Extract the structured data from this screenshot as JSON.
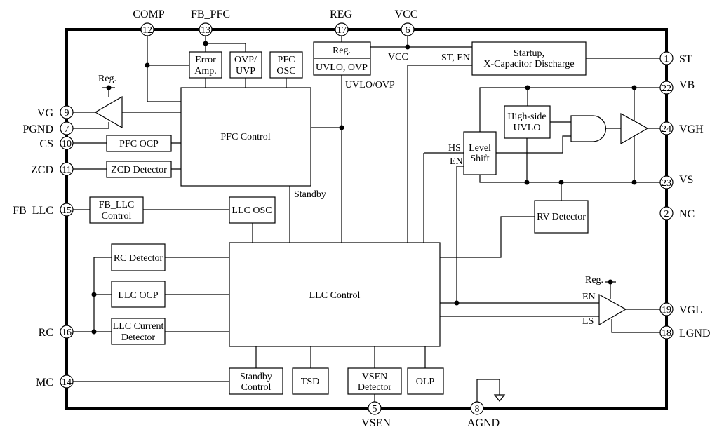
{
  "pins": {
    "comp": {
      "num": "12",
      "label": "COMP"
    },
    "fb_pfc": {
      "num": "13",
      "label": "FB_PFC"
    },
    "reg": {
      "num": "17",
      "label": "REG"
    },
    "vcc": {
      "num": "6",
      "label": "VCC"
    },
    "vg": {
      "num": "9",
      "label": "VG"
    },
    "pgnd": {
      "num": "7",
      "label": "PGND"
    },
    "cs": {
      "num": "10",
      "label": "CS"
    },
    "zcd": {
      "num": "11",
      "label": "ZCD"
    },
    "fb_llc": {
      "num": "15",
      "label": "FB_LLC"
    },
    "rc": {
      "num": "16",
      "label": "RC"
    },
    "mc": {
      "num": "14",
      "label": "MC"
    },
    "st": {
      "num": "1",
      "label": "ST"
    },
    "vb": {
      "num": "22",
      "label": "VB"
    },
    "vgh": {
      "num": "24",
      "label": "VGH"
    },
    "vs": {
      "num": "23",
      "label": "VS"
    },
    "nc": {
      "num": "2",
      "label": "NC"
    },
    "vgl": {
      "num": "19",
      "label": "VGL"
    },
    "lgnd": {
      "num": "18",
      "label": "LGND"
    },
    "vsen": {
      "num": "5",
      "label": "VSEN"
    },
    "agnd": {
      "num": "8",
      "label": "AGND"
    }
  },
  "blocks": {
    "error_amp": [
      "Error",
      "Amp."
    ],
    "ovp_uvp": [
      "OVP/",
      "UVP"
    ],
    "pfc_osc": [
      "PFC",
      "OSC"
    ],
    "reg": [
      "Reg.",
      "UVLO, OVP"
    ],
    "startup": [
      "Startup,",
      "X-Capacitor Discharge"
    ],
    "pfc_control": "PFC Control",
    "pfc_ocp": "PFC OCP",
    "zcd_detector": "ZCD Detector",
    "fb_llc_control": [
      "FB_LLC",
      "Control"
    ],
    "llc_osc": "LLC OSC",
    "llc_control": "LLC Control",
    "rc_detector": "RC Detector",
    "llc_ocp": "LLC OCP",
    "llc_current_detector": [
      "LLC Current",
      "Detector"
    ],
    "standby_control": [
      "Standby",
      "Control"
    ],
    "tsd": "TSD",
    "vsen_detector": [
      "VSEN",
      "Detector"
    ],
    "olp": "OLP",
    "high_side_uvlo": [
      "High-side",
      "UVLO"
    ],
    "level_shift": [
      "Level",
      "Shift"
    ],
    "rv_detector": "RV Detector"
  },
  "signals": {
    "reg_pfc": "Reg.",
    "reg_ls": "Reg.",
    "uvlo_ovp": "UVLO/OVP",
    "standby": "Standby",
    "vcc": "VCC",
    "st_en": "ST, EN",
    "hs": "HS",
    "en_ls": "EN",
    "en_drv": "EN",
    "ls": "LS"
  }
}
